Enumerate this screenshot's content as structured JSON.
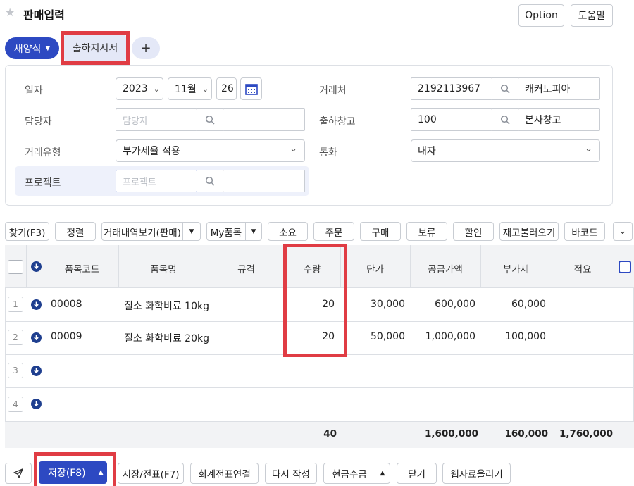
{
  "header": {
    "title": "판매입력",
    "option_label": "Option",
    "help_label": "도움말"
  },
  "tabs": {
    "template_label": "새양식",
    "shipping_label": "출하지시서",
    "add_label": "+"
  },
  "form": {
    "date_label": "일자",
    "year": "2023",
    "month": "11월",
    "day": "26",
    "manager_label": "담당자",
    "manager_placeholder": "담당자",
    "txn_type_label": "거래유형",
    "txn_type_value": "부가세율 적용",
    "project_label": "프로젝트",
    "project_placeholder": "프로젝트",
    "customer_label": "거래처",
    "customer_code": "2192113967",
    "customer_name": "캐커토피아",
    "warehouse_label": "출하창고",
    "warehouse_code": "100",
    "warehouse_name": "본사창고",
    "currency_label": "통화",
    "currency_value": "내자"
  },
  "toolbar": {
    "find_label": "찾기(F3)",
    "sort_label": "정렬",
    "history_label": "거래내역보기(판매)",
    "myitem_label": "My품목",
    "consume_label": "소요",
    "order_label": "주문",
    "purchase_label": "구매",
    "hold_label": "보류",
    "discount_label": "할인",
    "stock_label": "재고불러오기",
    "barcode_label": "바코드"
  },
  "table": {
    "headers": {
      "code": "품목코드",
      "name": "품목명",
      "spec": "규격",
      "qty": "수량",
      "price": "단가",
      "supply": "공급가액",
      "vat": "부가세",
      "note": "적요"
    },
    "rows": [
      {
        "num": "1",
        "code": "00008",
        "name": "질소 화학비료 10kg",
        "qty": "20",
        "price": "30,000",
        "supply": "600,000",
        "vat": "60,000"
      },
      {
        "num": "2",
        "code": "00009",
        "name": "질소 화학비료 20kg",
        "qty": "20",
        "price": "50,000",
        "supply": "1,000,000",
        "vat": "100,000"
      },
      {
        "num": "3"
      },
      {
        "num": "4"
      }
    ],
    "totals": {
      "qty": "40",
      "supply": "1,600,000",
      "vat": "160,000",
      "total": "1,760,000"
    }
  },
  "footer": {
    "save_label": "저장(F8)",
    "save_slip_label": "저장/전표(F7)",
    "accounting_label": "회계전표연결",
    "rewrite_label": "다시 작성",
    "cash_label": "현금수금",
    "close_label": "닫기",
    "upload_label": "웹자료올리기"
  },
  "colors": {
    "primary": "#2d49c2",
    "highlight": "#e03c44",
    "table_bg": "#f2f3f5"
  }
}
